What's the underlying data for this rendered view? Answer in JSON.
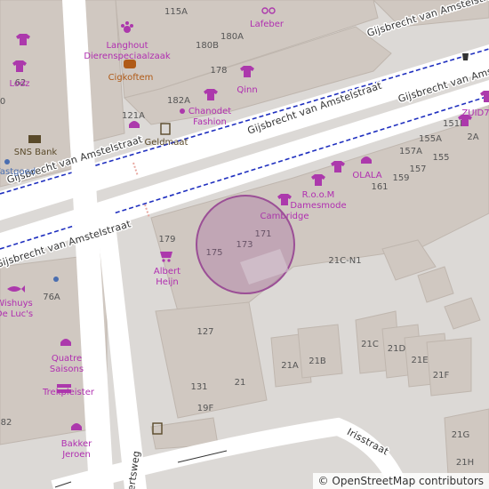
{
  "map": {
    "center_marker_color": "#9b4f96",
    "colors": {
      "land": "#dcd9d6",
      "building": "#d0c8c1",
      "road": "#ffffff",
      "bus_route": "#1f2fbf",
      "shop": "#ac39ac"
    },
    "streets": {
      "main_1": "Gijsbrecht van Amstelstraat",
      "main_2": "Gijsbrecht van Amstelstraat",
      "main_3": "Gijsbrecht van Amstelstraat",
      "main_4": "Gijsbrecht van Amstelstraat",
      "main_5": "Gijsbrecht van Amstelstraat",
      "side_1": "Irisstraat",
      "side_2": "ertsweg"
    },
    "house_numbers": {
      "n115a": "115A",
      "n180b": "180B",
      "n180a": "180A",
      "n178": "178",
      "n182a": "182A",
      "n121a": "121A",
      "n62": "62",
      "n0": "0",
      "n151b": "151B",
      "n2a": "2A",
      "n155a": "155A",
      "n157a": "157A",
      "n155": "155",
      "n157": "157",
      "n159": "159",
      "n161": "161",
      "n179": "179",
      "n175": "175",
      "n173": "173",
      "n171": "171",
      "n21cn1": "21C-N1",
      "n76a": "76A",
      "n127": "127",
      "n131": "131",
      "n21": "21",
      "n19f": "19F",
      "n21c": "21C",
      "n21d": "21D",
      "n21a": "21A",
      "n21b": "21B",
      "n21e": "21E",
      "n21f": "21F",
      "n21g": "21G",
      "n21h": "21H",
      "n82": "82"
    },
    "pois": {
      "langhout": [
        "Langhout",
        "Dierenspeciaalzaak"
      ],
      "cigkofte": "Cigkoftem",
      "lafeber": "Lafeber",
      "qinn": "Qinn",
      "chanodet": [
        "Chanodet",
        "Fashion"
      ],
      "geldmaat": "Geldmaat",
      "lodz": "Lodz",
      "sns": "SNS Bank",
      "vastgoed": "Vastgoed",
      "zuid": "ZUID7",
      "olala": "OLALA",
      "room": [
        "R.o.o.M",
        "Damesmode"
      ],
      "cambridge": "Cambridge",
      "albert": [
        "Albert",
        "Heijn"
      ],
      "wishuys": [
        "Wishuys",
        "De Luc's"
      ],
      "quatre": [
        "Quatre",
        "Saisons"
      ],
      "trekpleister": "Trekpleister",
      "bakker": [
        "Bakker",
        "Jeroen"
      ]
    },
    "attribution": {
      "symbol": "©",
      "text": "OpenStreetMap contributors"
    }
  }
}
